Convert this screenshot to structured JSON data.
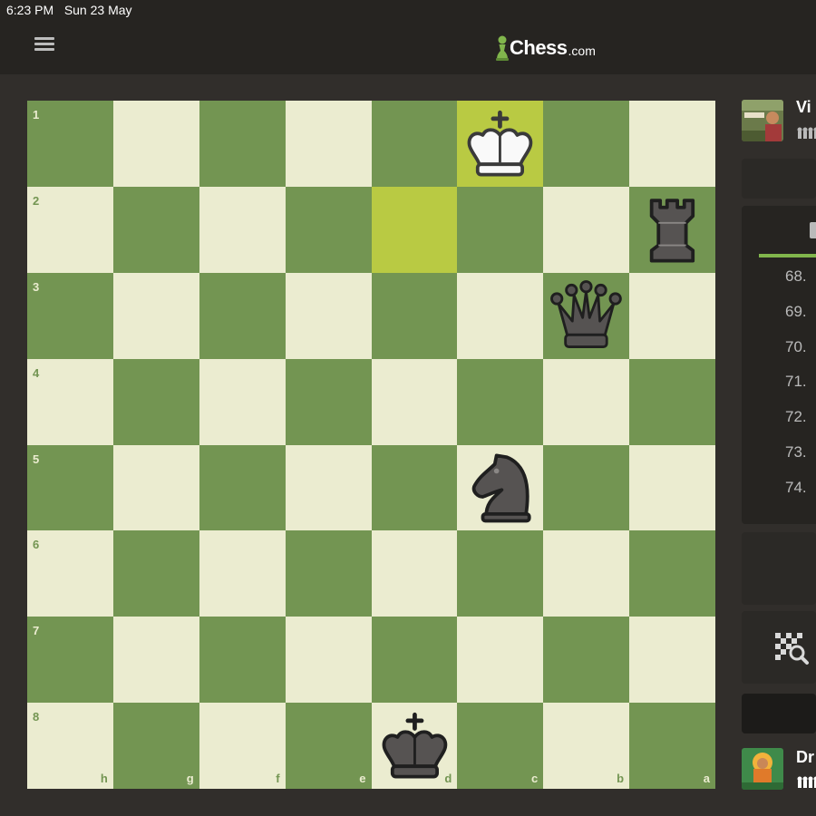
{
  "status_bar": {
    "time": "6:23 PM",
    "date": "Sun 23 May"
  },
  "header": {
    "logo_text": "Chess",
    "logo_domain": ".com",
    "menu_icon": "hamburger-icon"
  },
  "board": {
    "orientation": "black-bottom",
    "colors": {
      "light": "#ebecd0",
      "dark": "#739552",
      "highlight": "#b9ca43"
    },
    "rank_labels": [
      "1",
      "2",
      "3",
      "4",
      "5",
      "6",
      "7",
      "8"
    ],
    "file_labels": [
      "h",
      "g",
      "f",
      "e",
      "d",
      "c",
      "b",
      "a"
    ],
    "highlighted_squares": [
      "c1",
      "d2"
    ],
    "pieces": [
      {
        "square": "c1",
        "piece": "white-king"
      },
      {
        "square": "a2",
        "piece": "black-rook"
      },
      {
        "square": "b3",
        "piece": "black-queen"
      },
      {
        "square": "c5",
        "piece": "black-knight"
      },
      {
        "square": "d8",
        "piece": "black-king"
      }
    ]
  },
  "top_player": {
    "name": "Vi"
  },
  "bottom_player": {
    "name": "Dr"
  },
  "move_list": {
    "numbers": [
      "68.",
      "69.",
      "70.",
      "71.",
      "72.",
      "73.",
      "74."
    ]
  },
  "analysis_icon": "board-analysis-icon"
}
